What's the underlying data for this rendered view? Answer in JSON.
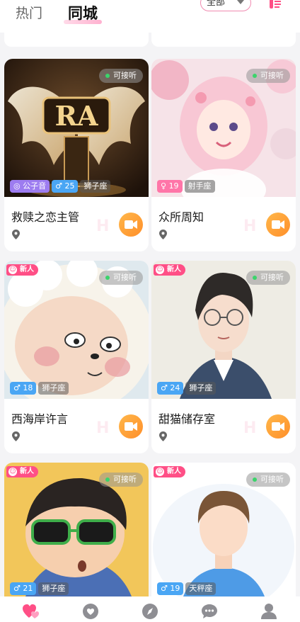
{
  "header": {
    "tabs": [
      {
        "label": "热门",
        "active": false
      },
      {
        "label": "同城",
        "active": true
      }
    ],
    "filter": {
      "selected": "全部"
    },
    "filter_icon": "filter-icon"
  },
  "badges": {
    "live": "可接听",
    "new": "新人",
    "new_icon": "face-icon"
  },
  "cards": [
    {
      "name": "救赎之恋主管",
      "voice": "公子音",
      "gender": "male",
      "age": "25",
      "zodiac": "狮子座",
      "is_new": false,
      "live": true
    },
    {
      "name": "众所周知",
      "voice": null,
      "gender": "female",
      "age": "19",
      "zodiac": "射手座",
      "is_new": false,
      "live": true
    },
    {
      "name": "西海岸许言",
      "voice": null,
      "gender": "male",
      "age": "18",
      "zodiac": "狮子座",
      "is_new": true,
      "live": true
    },
    {
      "name": "甜猫储存室",
      "voice": null,
      "gender": "male",
      "age": "24",
      "zodiac": "狮子座",
      "is_new": true,
      "live": true
    },
    {
      "name": "",
      "voice": null,
      "gender": "male",
      "age": "21",
      "zodiac": "狮子座",
      "is_new": true,
      "live": true
    },
    {
      "name": "",
      "voice": null,
      "gender": "male",
      "age": "19",
      "zodiac": "天秤座",
      "is_new": true,
      "live": true
    }
  ],
  "symbols": {
    "male": "♂",
    "female": "♀",
    "voice": "◎"
  },
  "colors": {
    "accent": "#ff4f86",
    "video": "#ff9a30",
    "male": "#4aa6f4",
    "female": "#ff75a8",
    "voice": "#9d7cf0"
  },
  "nav": [
    {
      "icon": "home-hearts-icon",
      "active": true
    },
    {
      "icon": "heart-chat-icon",
      "active": false
    },
    {
      "icon": "compass-icon",
      "active": false
    },
    {
      "icon": "message-icon",
      "active": false
    },
    {
      "icon": "profile-icon",
      "active": false
    }
  ]
}
